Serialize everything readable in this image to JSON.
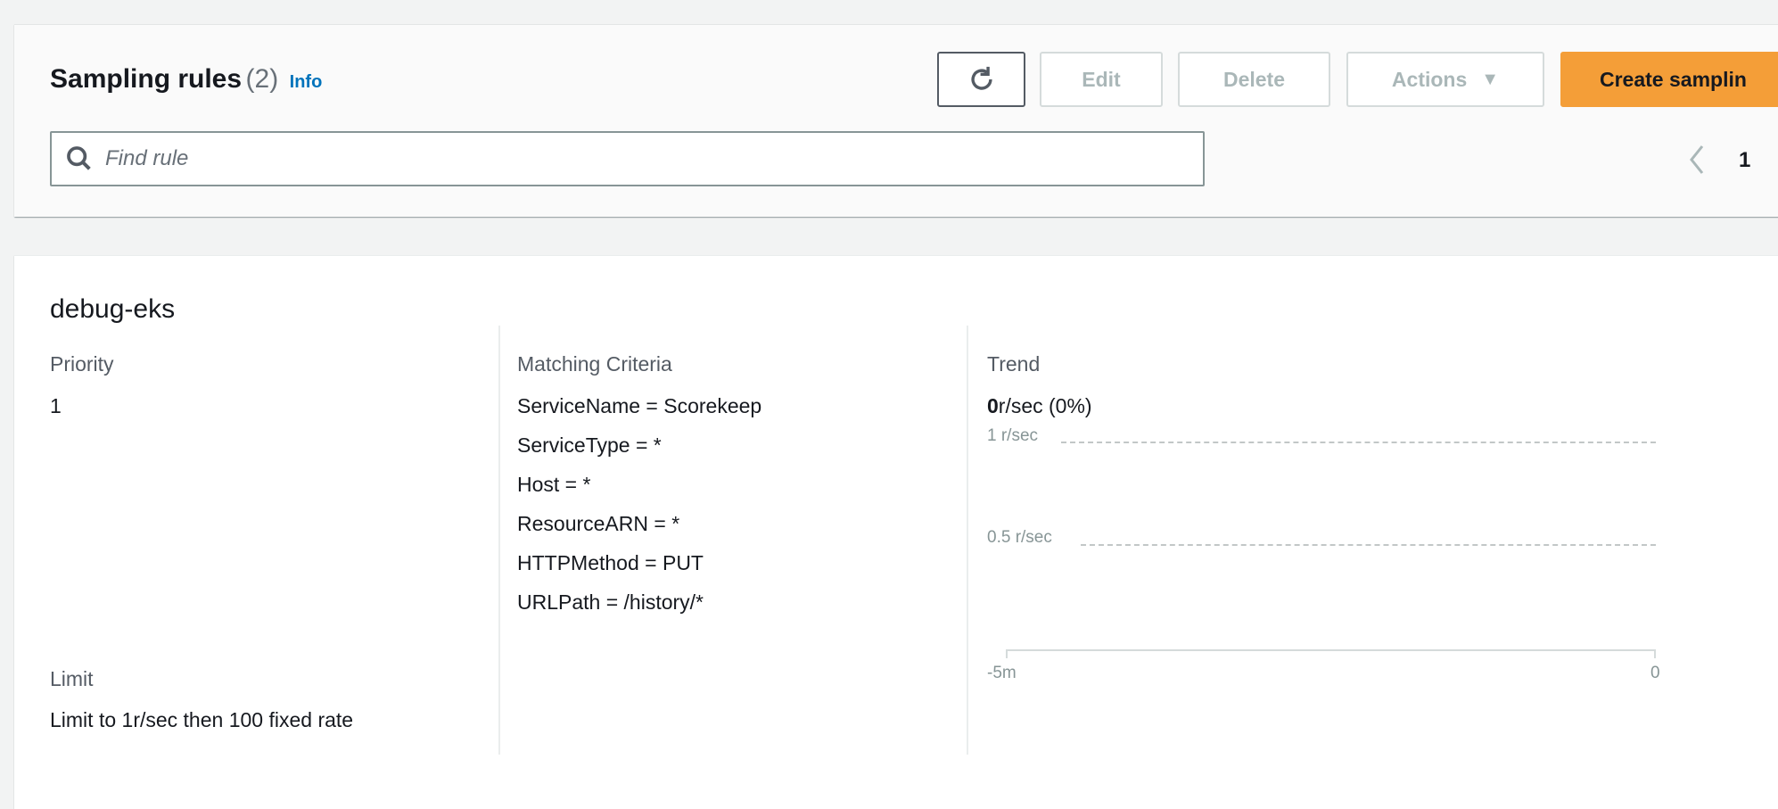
{
  "header": {
    "title": "Sampling rules",
    "count": "(2)",
    "info_link": "Info",
    "buttons": {
      "refresh_icon": "refresh-icon",
      "edit": "Edit",
      "delete": "Delete",
      "actions": "Actions",
      "create": "Create samplin"
    },
    "search": {
      "placeholder": "Find rule",
      "value": ""
    },
    "pagination": {
      "current_page": "1"
    }
  },
  "rule": {
    "name": "debug-eks",
    "priority_label": "Priority",
    "priority_value": "1",
    "limit_label": "Limit",
    "limit_value": "Limit to 1r/sec then 100 fixed rate",
    "criteria_label": "Matching Criteria",
    "criteria": [
      "ServiceName = Scorekeep",
      "ServiceType = *",
      "Host = *",
      "ResourceARN = *",
      "HTTPMethod = PUT",
      "URLPath = /history/*"
    ],
    "trend": {
      "label": "Trend",
      "current_bold": "0",
      "current_rest": "r/sec (0%)",
      "y_ticks": [
        "1 r/sec",
        "0.5 r/sec"
      ],
      "x_ticks": [
        "-5m",
        "0"
      ]
    }
  },
  "colors": {
    "primary": "#f49e38",
    "link": "#0073bb"
  }
}
